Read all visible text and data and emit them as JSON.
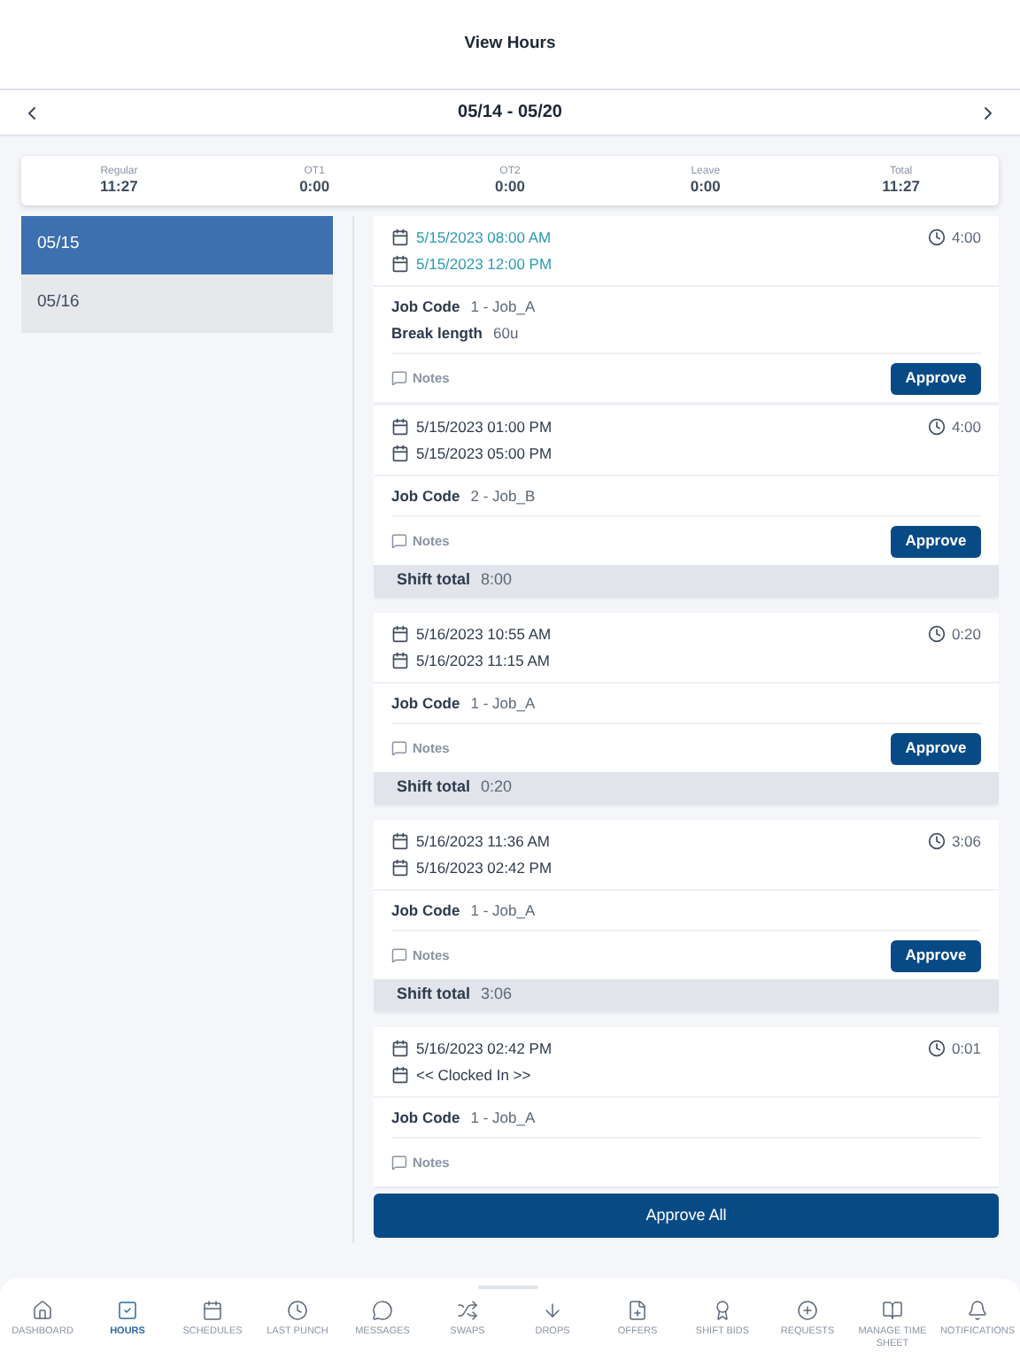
{
  "header": {
    "title": "View Hours"
  },
  "period": {
    "label": "05/14 - 05/20"
  },
  "summary": [
    {
      "label": "Regular",
      "value": "11:27"
    },
    {
      "label": "OT1",
      "value": "0:00"
    },
    {
      "label": "OT2",
      "value": "0:00"
    },
    {
      "label": "Leave",
      "value": "0:00"
    },
    {
      "label": "Total",
      "value": "11:27"
    }
  ],
  "days": [
    {
      "label": "05/15",
      "selected": true
    },
    {
      "label": "05/16",
      "selected": false
    }
  ],
  "shifts": [
    {
      "entries": [
        {
          "start": "5/15/2023 08:00 AM",
          "end": "5/15/2023 12:00 PM",
          "highlighted": true,
          "duration": "4:00",
          "details": [
            {
              "label": "Job Code",
              "value": "1 - Job_A"
            },
            {
              "label": "Break length",
              "value": "60u"
            }
          ],
          "notes": "Notes",
          "approve": "Approve"
        },
        {
          "start": "5/15/2023 01:00 PM",
          "end": "5/15/2023 05:00 PM",
          "highlighted": false,
          "duration": "4:00",
          "details": [
            {
              "label": "Job Code",
              "value": "2 - Job_B"
            }
          ],
          "notes": "Notes",
          "approve": "Approve"
        }
      ],
      "total_label": "Shift total",
      "total": "8:00"
    },
    {
      "entries": [
        {
          "start": "5/16/2023 10:55 AM",
          "end": "5/16/2023 11:15 AM",
          "highlighted": false,
          "duration": "0:20",
          "details": [
            {
              "label": "Job Code",
              "value": "1 - Job_A"
            }
          ],
          "notes": "Notes",
          "approve": "Approve"
        }
      ],
      "total_label": "Shift total",
      "total": "0:20"
    },
    {
      "entries": [
        {
          "start": "5/16/2023 11:36 AM",
          "end": "5/16/2023 02:42 PM",
          "highlighted": false,
          "duration": "3:06",
          "details": [
            {
              "label": "Job Code",
              "value": "1 - Job_A"
            }
          ],
          "notes": "Notes",
          "approve": "Approve"
        }
      ],
      "total_label": "Shift total",
      "total": "3:06"
    },
    {
      "entries": [
        {
          "start": "5/16/2023 02:42 PM",
          "end": "<< Clocked In >>",
          "highlighted": false,
          "duration": "0:01",
          "details": [
            {
              "label": "Job Code",
              "value": "1 - Job_A"
            }
          ],
          "notes": "Notes"
        }
      ]
    }
  ],
  "approve_all": "Approve All",
  "nav": [
    {
      "label": "DASHBOARD",
      "selected": false
    },
    {
      "label": "HOURS",
      "selected": true
    },
    {
      "label": "SCHEDULES",
      "selected": false
    },
    {
      "label": "LAST PUNCH",
      "selected": false
    },
    {
      "label": "MESSAGES",
      "selected": false
    },
    {
      "label": "SWAPS",
      "selected": false
    },
    {
      "label": "DROPS",
      "selected": false
    },
    {
      "label": "OFFERS",
      "selected": false
    },
    {
      "label": "SHIFT BIDS",
      "selected": false
    },
    {
      "label": "REQUESTS",
      "selected": false
    },
    {
      "label": "MANAGE TIME SHEET",
      "selected": false
    },
    {
      "label": "NOTIFICATIONS",
      "selected": false
    }
  ]
}
